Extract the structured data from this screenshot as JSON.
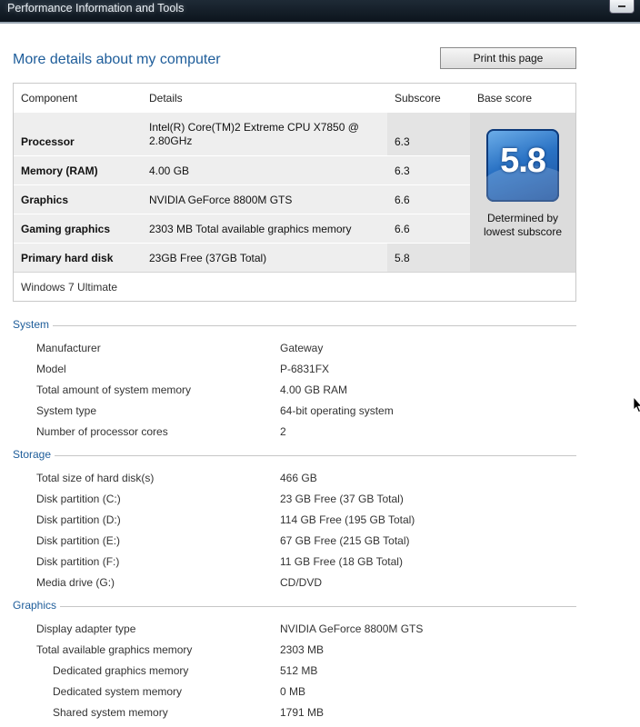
{
  "window": {
    "title": "Performance Information and Tools"
  },
  "heading": "More details about my computer",
  "print_button": "Print this page",
  "score_table": {
    "headers": {
      "component": "Component",
      "details": "Details",
      "subscore": "Subscore",
      "base_score": "Base score"
    },
    "rows": [
      {
        "component": "Processor",
        "details": "Intel(R) Core(TM)2 Extreme CPU X7850 @ 2.80GHz",
        "subscore": "6.3"
      },
      {
        "component": "Memory (RAM)",
        "details": "4.00 GB",
        "subscore": "6.3"
      },
      {
        "component": "Graphics",
        "details": "NVIDIA GeForce 8800M GTS",
        "subscore": "6.6"
      },
      {
        "component": "Gaming graphics",
        "details": "2303 MB Total available graphics memory",
        "subscore": "6.6"
      },
      {
        "component": "Primary hard disk",
        "details": "23GB Free (37GB Total)",
        "subscore": "5.8"
      }
    ],
    "base_score": "5.8",
    "base_note": "Determined by lowest subscore",
    "os": "Windows 7 Ultimate"
  },
  "system": {
    "title": "System",
    "items": [
      {
        "label": "Manufacturer",
        "value": "Gateway"
      },
      {
        "label": "Model",
        "value": "P-6831FX"
      },
      {
        "label": "Total amount of system memory",
        "value": "4.00 GB RAM"
      },
      {
        "label": "System type",
        "value": "64-bit operating system"
      },
      {
        "label": "Number of processor cores",
        "value": "2"
      }
    ]
  },
  "storage": {
    "title": "Storage",
    "items": [
      {
        "label": "Total size of hard disk(s)",
        "value": "466 GB"
      },
      {
        "label": "Disk partition (C:)",
        "value": "23 GB Free (37 GB Total)"
      },
      {
        "label": "Disk partition (D:)",
        "value": "114 GB Free (195 GB Total)"
      },
      {
        "label": "Disk partition (E:)",
        "value": "67 GB Free (215 GB Total)"
      },
      {
        "label": "Disk partition (F:)",
        "value": "11 GB Free (18 GB Total)"
      },
      {
        "label": "Media drive (G:)",
        "value": "CD/DVD"
      }
    ]
  },
  "graphics": {
    "title": "Graphics",
    "items": [
      {
        "label": "Display adapter type",
        "value": "NVIDIA GeForce 8800M GTS"
      },
      {
        "label": "Total available graphics memory",
        "value": "2303 MB"
      },
      {
        "label": "Dedicated graphics memory",
        "value": "512 MB"
      },
      {
        "label": "Dedicated system memory",
        "value": "0 MB"
      },
      {
        "label": "Shared system memory",
        "value": "1791 MB"
      }
    ]
  },
  "colors": {
    "accent": "#1e5d9a",
    "badge": "#2a72c4"
  }
}
